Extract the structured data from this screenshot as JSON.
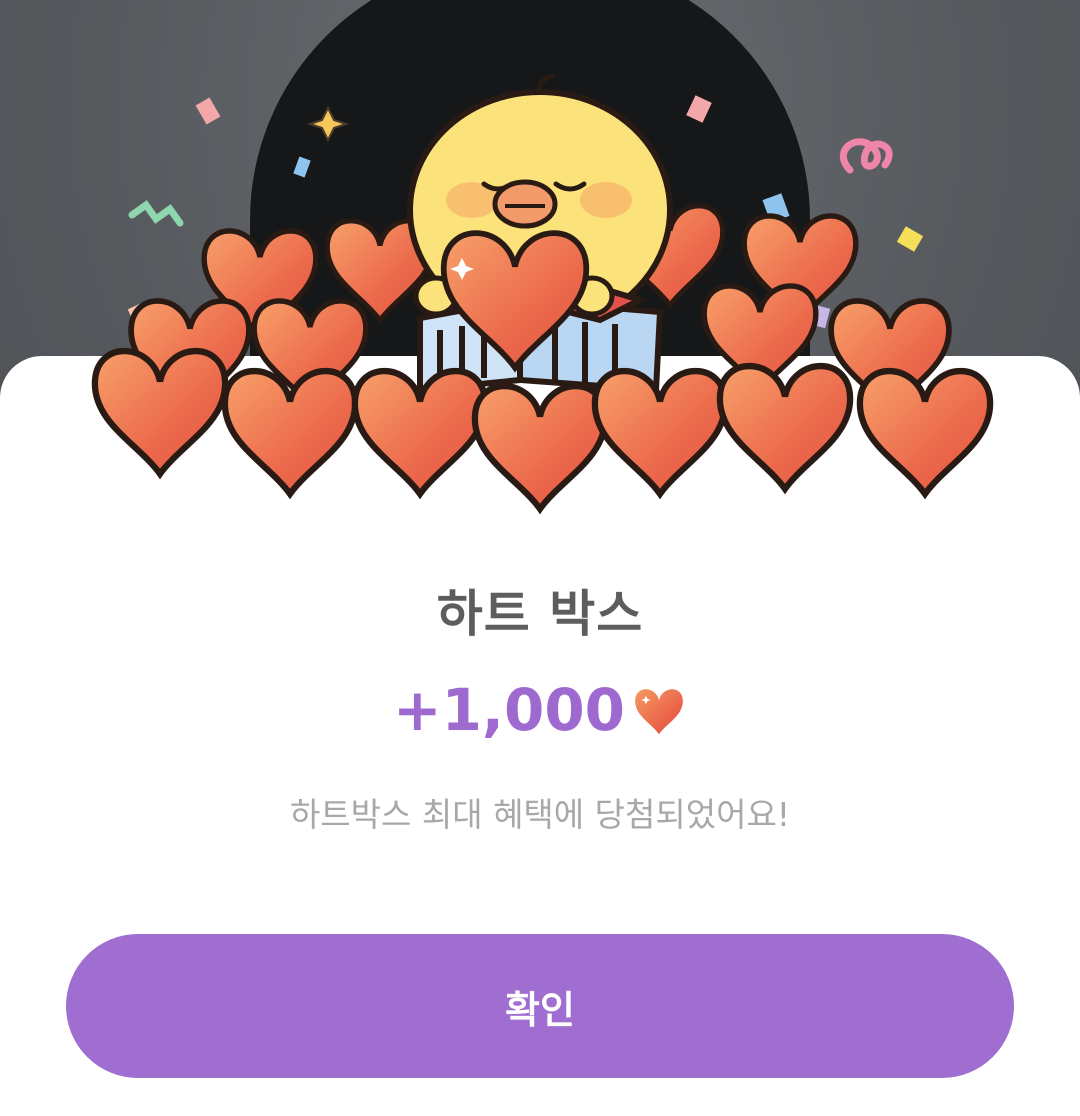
{
  "popup": {
    "title": "하트 박스",
    "amount": "+1,000",
    "amount_icon": "heart-icon",
    "message": "하트박스 최대 혜택에 당첨되었어요!",
    "confirm_label": "확인"
  },
  "colors": {
    "accent": "#a06dd0",
    "amount_text": "#9f6ad0",
    "title_text": "#5d5d5d",
    "message_text": "#a8a8a8",
    "heart": "#ef6a4a"
  }
}
